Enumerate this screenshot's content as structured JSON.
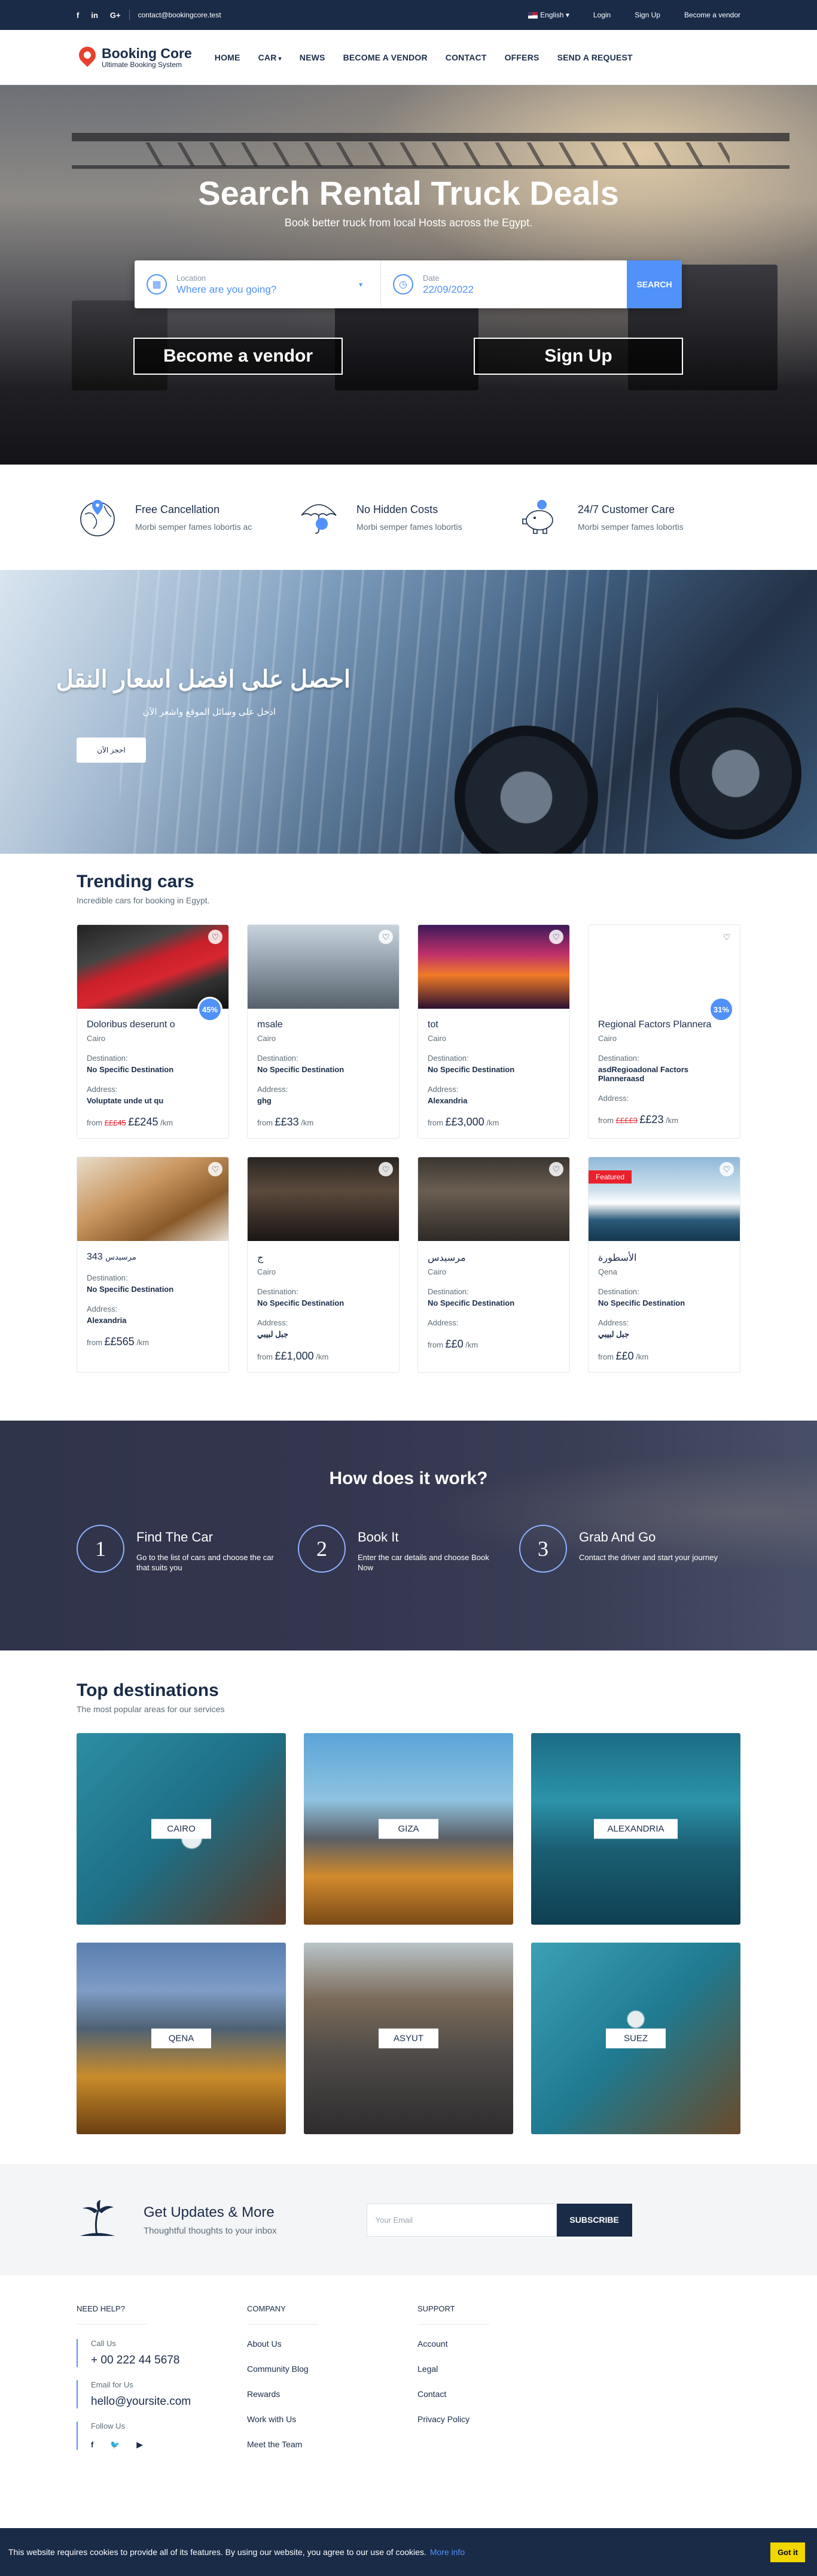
{
  "topbar": {
    "social": [
      "f",
      "in",
      "G+"
    ],
    "email": "contact@bookingcore.test",
    "language": "English",
    "links": [
      "Login",
      "Sign Up",
      "Become a vendor"
    ]
  },
  "header": {
    "logo_title": "Booking Core",
    "logo_tagline": "Ultimate Booking System",
    "nav": [
      "HOME",
      "CAR",
      "NEWS",
      "BECOME A VENDOR",
      "CONTACT",
      "OFFERS",
      "SEND A REQUEST"
    ]
  },
  "hero": {
    "title": "Search Rental Truck Deals",
    "subtitle": "Book better truck from local Hosts across the Egypt.",
    "location_label": "Location",
    "location_placeholder": "Where are you going?",
    "date_label": "Date",
    "date_value": "22/09/2022",
    "search_button": "SEARCH",
    "vendor_button": "Become a vendor",
    "signup_button": "Sign Up"
  },
  "features": [
    {
      "title": "Free Cancellation",
      "desc": "Morbi semper fames lobortis ac"
    },
    {
      "title": "No Hidden Costs",
      "desc": "Morbi semper fames lobortis"
    },
    {
      "title": "24/7 Customer Care",
      "desc": "Morbi semper fames lobortis"
    }
  ],
  "promo": {
    "title": "احصل على افضل اسعار النقل",
    "subtitle": "ادخل على وسائل الموقع واشعر الآن",
    "button": "احجز الآن"
  },
  "trending": {
    "title": "Trending cars",
    "subtitle": "Incredible cars for booking in Egypt.",
    "dest_label": "Destination:",
    "addr_label": "Address:",
    "from": "from",
    "unit": "/km",
    "cards": [
      {
        "name": "Doloribus deserunt o",
        "city": "Cairo",
        "dest": "No Specific Destination",
        "addr": "Voluptate unde ut qu",
        "old": "£££45",
        "price": "££245",
        "badge": "45%"
      },
      {
        "name": "msale",
        "city": "Cairo",
        "dest": "No Specific Destination",
        "addr": "ghg",
        "old": "",
        "price": "££33",
        "badge": ""
      },
      {
        "name": "tot",
        "city": "Cairo",
        "dest": "No Specific Destination",
        "addr": "Alexandria",
        "old": "",
        "price": "££3,000",
        "badge": ""
      },
      {
        "name": "Regional Factors Plannera",
        "city": "Cairo",
        "dest": "asdRegioadonal Factors Planneraasd",
        "addr": "",
        "old": "££££3",
        "price": "££23",
        "badge": "31%"
      },
      {
        "name": "343",
        "name2": "مرسيدس",
        "city": "",
        "dest": "No Specific Destination",
        "addr": "Alexandria",
        "old": "",
        "price": "££565",
        "badge": ""
      },
      {
        "name": "ج",
        "city": "Cairo",
        "dest": "No Specific Destination",
        "addr": "جبل لبيبي",
        "old": "",
        "price": "££1,000",
        "badge": ""
      },
      {
        "name": "مرسيدس",
        "city": "Cairo",
        "dest": "No Specific Destination",
        "addr": "",
        "old": "",
        "price": "££0",
        "badge": ""
      },
      {
        "name": "الأسطورة",
        "city": "Qena",
        "dest": "No Specific Destination",
        "addr": "جبل لبيبي",
        "old": "",
        "price": "££0",
        "badge": "",
        "featured": "Featured"
      }
    ]
  },
  "how": {
    "title": "How does it work?",
    "steps": [
      {
        "num": "1",
        "title": "Find The Car",
        "desc": "Go to the list of cars and choose the car that suits you"
      },
      {
        "num": "2",
        "title": "Book It",
        "desc": "Enter the car details and choose Book Now"
      },
      {
        "num": "3",
        "title": "Grab And Go",
        "desc": "Contact the driver and start your journey"
      }
    ]
  },
  "destinations": {
    "title": "Top destinations",
    "subtitle": "The most popular areas for our services",
    "items": [
      "CAIRO",
      "GIZA",
      "ALEXANDRIA",
      "QENA",
      "ASYUT",
      "SUEZ"
    ]
  },
  "newsletter": {
    "title": "Get Updates & More",
    "subtitle": "Thoughtful thoughts to your inbox",
    "placeholder": "Your Email",
    "button": "SUBSCRIBE"
  },
  "footer": {
    "need_help": "NEED HELP?",
    "call_label": "Call Us",
    "phone": "+ 00 222 44 5678",
    "email_label": "Email for Us",
    "email": "hello@yoursite.com",
    "follow_label": "Follow Us",
    "company": "COMPANY",
    "company_links": [
      "About Us",
      "Community Blog",
      "Rewards",
      "Work with Us",
      "Meet the Team"
    ],
    "support": "SUPPORT",
    "support_links": [
      "Account",
      "Legal",
      "Contact",
      "Privacy Policy"
    ]
  },
  "cookie": {
    "text": "This website requires cookies to provide all of its features. By using our website, you agree to our use of cookies.",
    "more": "More info",
    "button": "Got it"
  },
  "colors": {
    "primary": "#5191fa",
    "navy": "#1a2b48",
    "red": "#e8212d",
    "yellow": "#f1d600"
  }
}
